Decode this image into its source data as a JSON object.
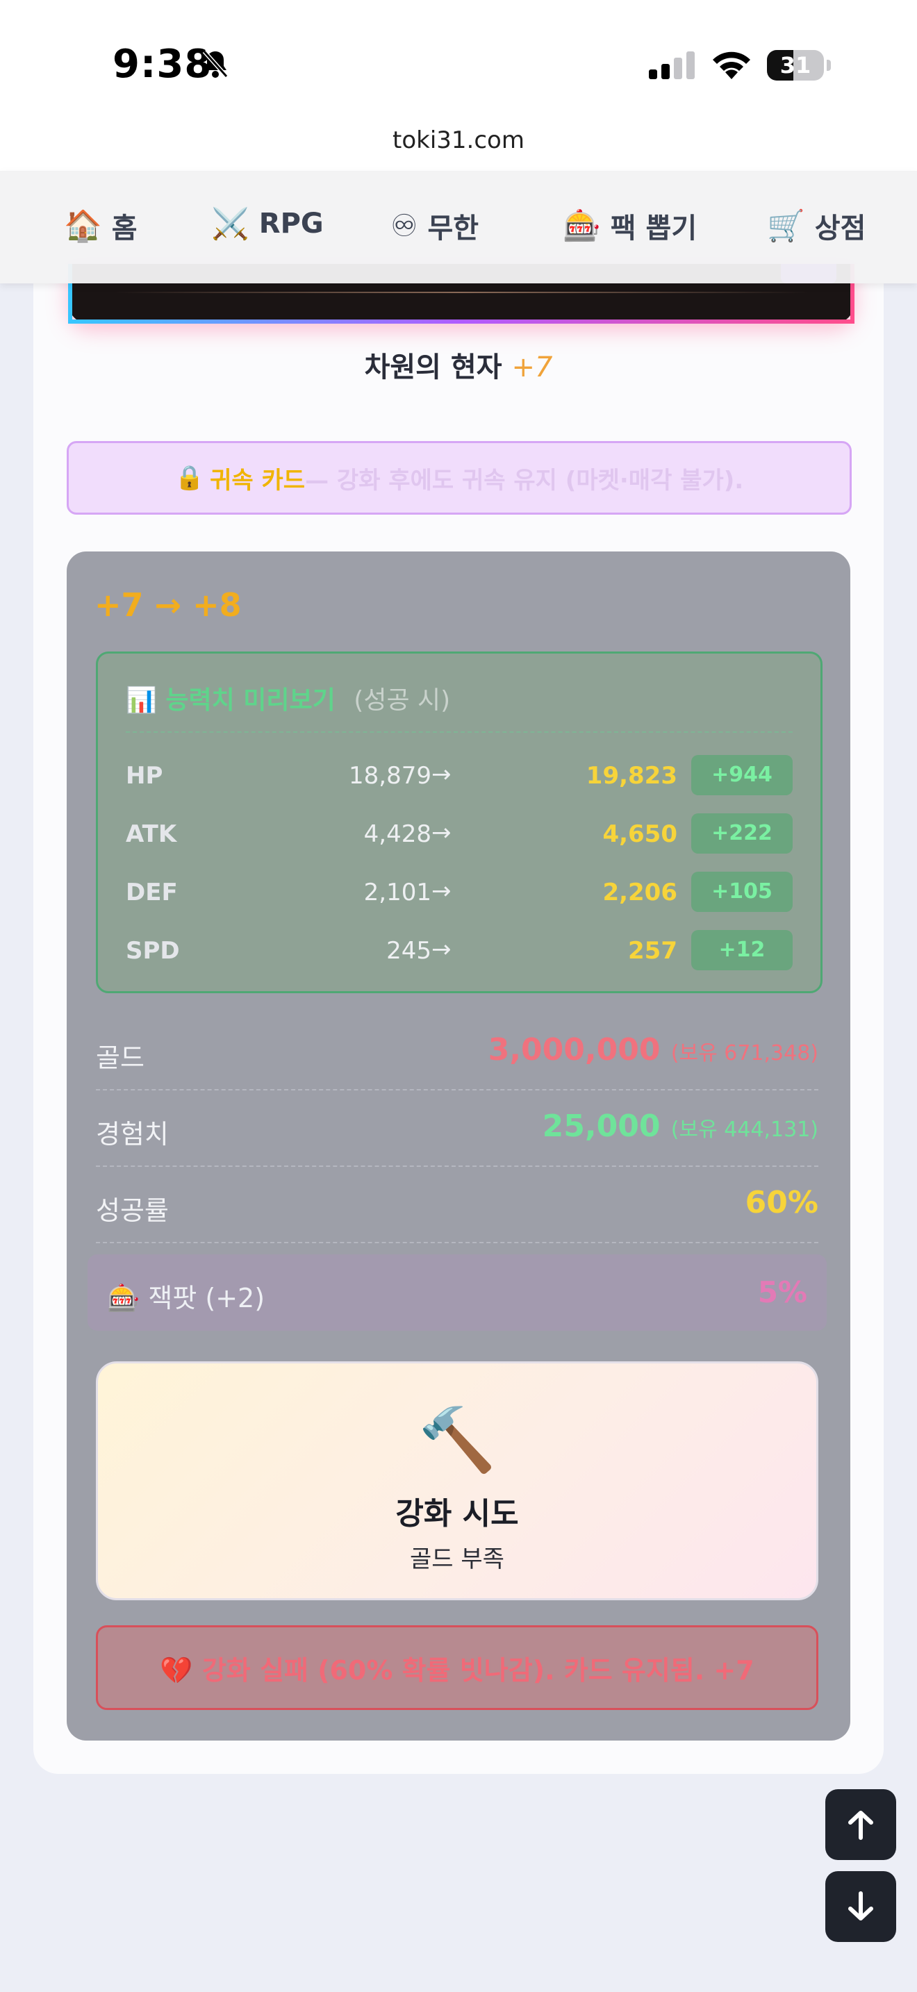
{
  "status": {
    "time": "9:38",
    "battery": "31"
  },
  "browser": {
    "url": "toki31.com"
  },
  "nav": [
    {
      "icon": "🏠",
      "label": "홈"
    },
    {
      "icon": "⚔️",
      "label": "RPG"
    },
    {
      "icon": "♾",
      "label": "무한"
    },
    {
      "icon": "🎰",
      "label": "팩 뽑기"
    },
    {
      "icon": "🛒",
      "label": "상점"
    }
  ],
  "card": {
    "name": "차원의 현자",
    "level": "+7"
  },
  "bound": {
    "icon": "🔒",
    "title": "귀속 카드",
    "text": " — 강화 후에도 귀속 유지 (마켓·매각 불가)."
  },
  "enhance": {
    "title": "+7 → +8",
    "preview": {
      "icon": "📊",
      "title": "능력치 미리보기",
      "subtitle": "(성공 시)",
      "stats": [
        {
          "name": "HP",
          "old": "18,879",
          "arrow": "→",
          "new": "19,823",
          "delta": "+944"
        },
        {
          "name": "ATK",
          "old": "4,428",
          "arrow": "→",
          "new": "4,650",
          "delta": "+222"
        },
        {
          "name": "DEF",
          "old": "2,101",
          "arrow": "→",
          "new": "2,206",
          "delta": "+105"
        },
        {
          "name": "SPD",
          "old": "245",
          "arrow": "→",
          "new": "257",
          "delta": "+12"
        }
      ]
    },
    "costs": {
      "gold": {
        "label": "골드",
        "value": "3,000,000",
        "owned": "(보유 671,348)"
      },
      "exp": {
        "label": "경험치",
        "value": "25,000",
        "owned": "(보유 444,131)"
      },
      "rate": {
        "label": "성공률",
        "value": "60%"
      }
    },
    "jackpot": {
      "label": "🎰 잭팟 (+2)",
      "value": "5%"
    },
    "button": {
      "icon": "🔨",
      "label": "강화 시도",
      "sub": "골드 부족"
    },
    "result": "💔 강화 실패 (60% 확률 빗나감). 카드 유지됨. +7"
  },
  "colors": {
    "gold_value": "#f0727e",
    "exp_value": "#6fe39a",
    "rate_value": "#f7d43a",
    "title": "#f2ad1e"
  }
}
